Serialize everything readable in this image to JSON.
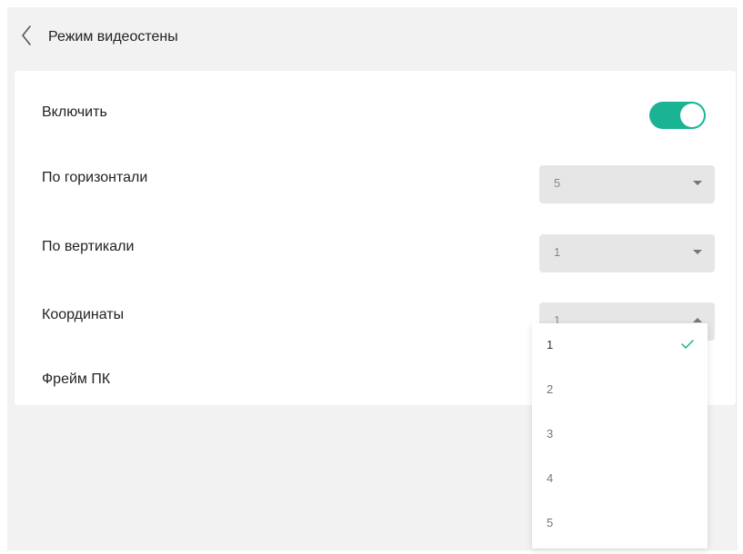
{
  "header": {
    "title": "Режим видеостены"
  },
  "settings": {
    "enable_label": "Включить",
    "enable_on": true,
    "horizontal_label": "По горизонтали",
    "horizontal_value": "5",
    "vertical_label": "По вертикали",
    "vertical_value": "1",
    "coordinates_label": "Координаты",
    "coordinates_value": "1",
    "pc_frame_label": "Фрейм ПК"
  },
  "dropdown": {
    "options": [
      "1",
      "2",
      "3",
      "4",
      "5"
    ],
    "selected": "1"
  },
  "colors": {
    "accent": "#1ab394",
    "background": "#f2f2f2",
    "card": "#ffffff",
    "select_bg": "#e6e6e6"
  },
  "icons": {
    "back": "chevron-left-icon",
    "dropdown_closed": "caret-down-icon",
    "dropdown_open": "caret-up-icon",
    "selected": "check-icon"
  }
}
